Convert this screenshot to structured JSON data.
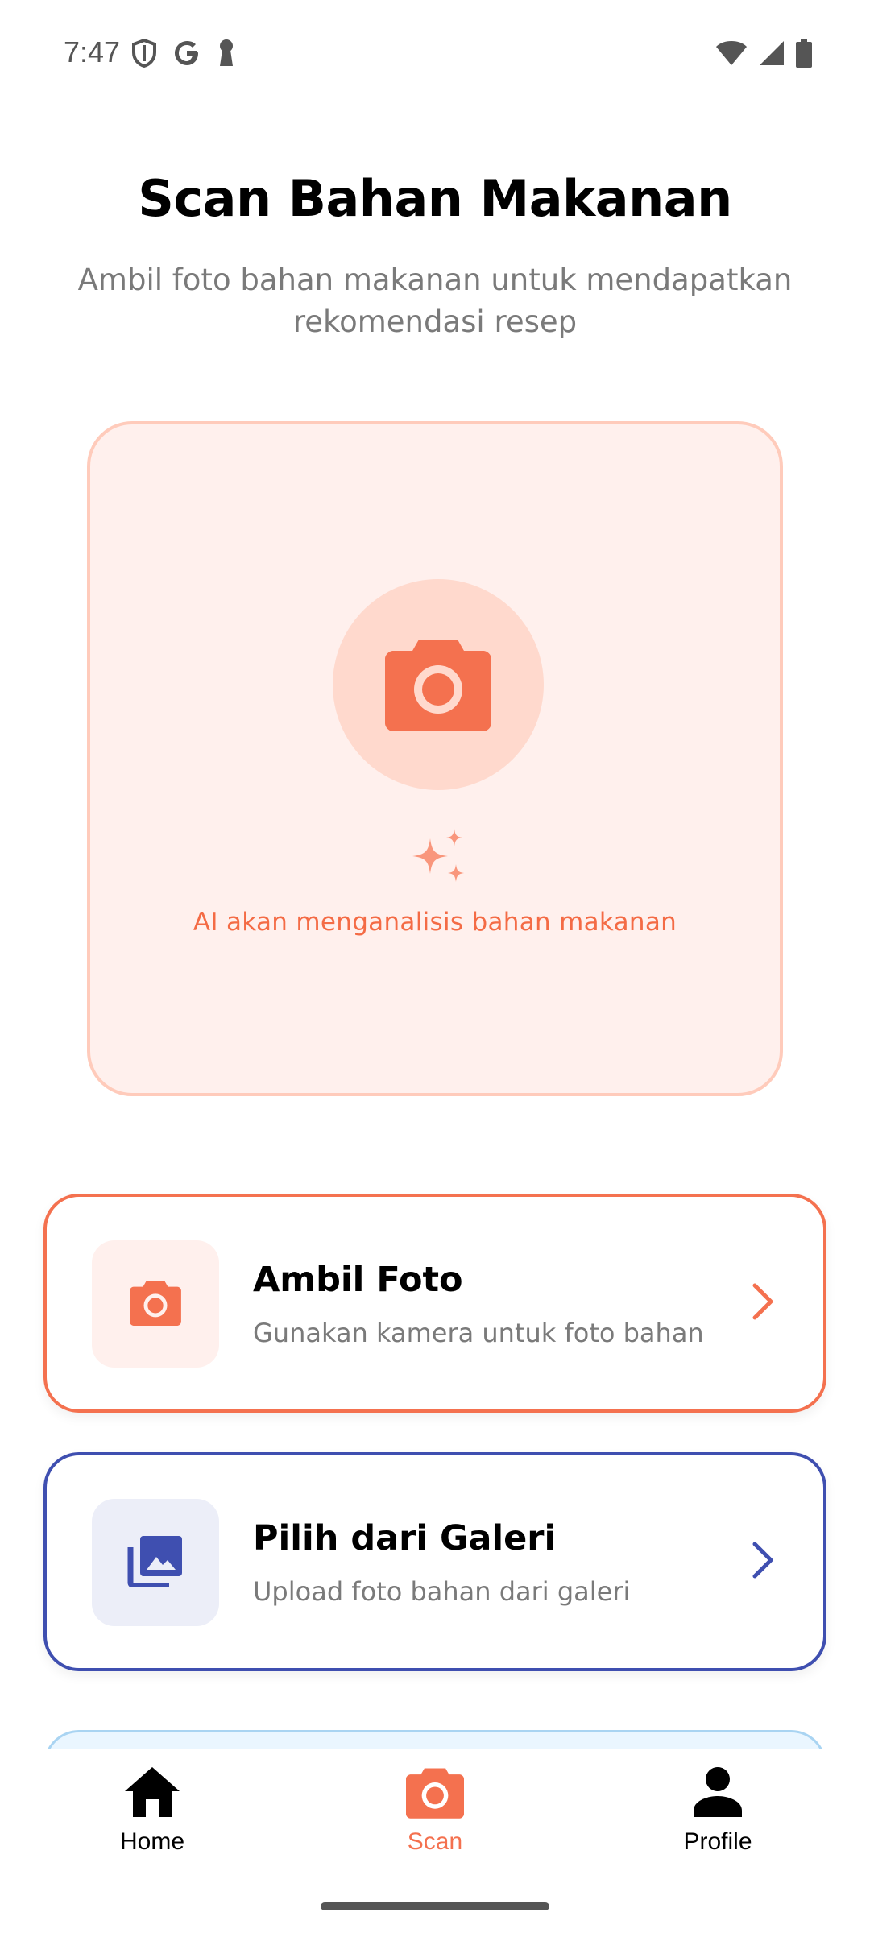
{
  "status_bar": {
    "time": "7:47",
    "left_icons": [
      "shield-icon",
      "google-icon",
      "keyhole-icon"
    ],
    "right_icons": [
      "wifi-icon",
      "signal-icon",
      "battery-icon"
    ]
  },
  "header": {
    "title": "Scan Bahan Makanan",
    "subtitle": "Ambil foto bahan makanan untuk mendapatkan rekomendasi resep"
  },
  "scan_area": {
    "icon": "camera-icon",
    "sparkle_icon": "sparkle-icon",
    "ai_text": "AI akan menganalisis bahan makanan"
  },
  "options": [
    {
      "title": "Ambil Foto",
      "description": "Gunakan kamera untuk foto bahan",
      "icon": "camera-icon",
      "accent": "#f4714f"
    },
    {
      "title": "Pilih dari Galeri",
      "description": "Upload foto bahan dari galeri",
      "icon": "gallery-icon",
      "accent": "#3f4fb0"
    }
  ],
  "bottom_nav": {
    "items": [
      {
        "label": "Home",
        "icon": "home-icon",
        "active": false
      },
      {
        "label": "Scan",
        "icon": "camera-icon",
        "active": true
      },
      {
        "label": "Profile",
        "icon": "person-icon",
        "active": false
      }
    ],
    "active_color": "#f4714f"
  }
}
